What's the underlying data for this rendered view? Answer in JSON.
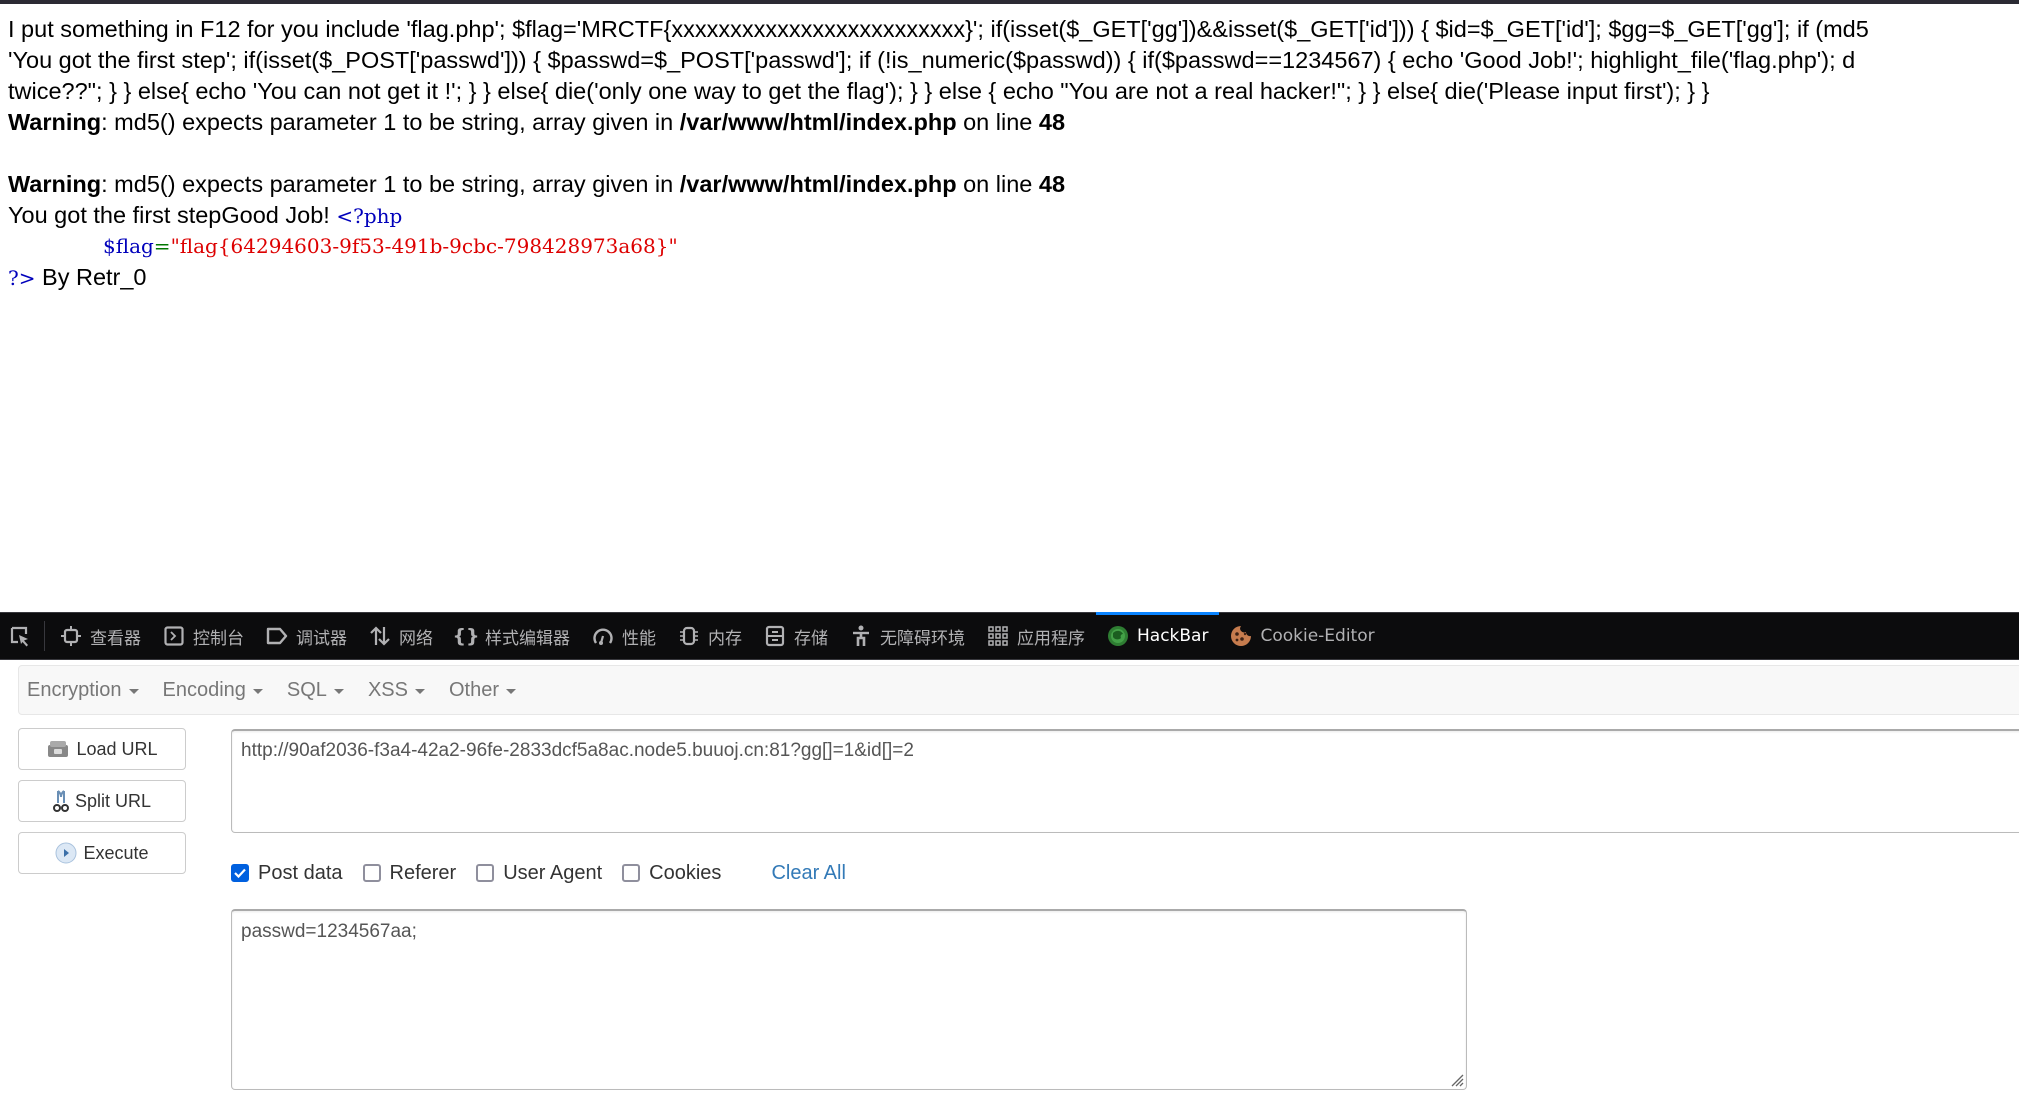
{
  "page": {
    "source_lines": [
      "I put something in F12 for you include 'flag.php'; $flag='MRCTF{xxxxxxxxxxxxxxxxxxxxxxxxx}'; if(isset($_GET['gg'])&&isset($_GET['id'])) { $id=$_GET['id']; $gg=$_GET['gg']; if (md5",
      "'You got the first step'; if(isset($_POST['passwd'])) { $passwd=$_POST['passwd']; if (!is_numeric($passwd)) { if($passwd==1234567) { echo 'Good Job!'; highlight_file('flag.php'); d",
      "twice??\"; } } else{ echo 'You can not get it !'; } } else{ die('only one way to get the flag'); } } else { echo \"You are not a real hacker!\"; } } else{ die('Please input first'); } }"
    ],
    "warnings": [
      {
        "label": "Warning",
        "message": ": md5() expects parameter 1 to be string, array given in ",
        "file": "/var/www/html/index.php",
        "on_line": " on line ",
        "line": "48"
      },
      {
        "label": "Warning",
        "message": ": md5() expects parameter 1 to be string, array given in ",
        "file": "/var/www/html/index.php",
        "on_line": " on line ",
        "line": "48"
      }
    ],
    "output_text": "You got the first stepGood Job! ",
    "php_open": "<?php",
    "flag_var": "$flag",
    "flag_eq": "=",
    "flag_value": "\"flag{64294603-9f53-491b-9cbc-798428973a68}\"",
    "php_close": "?>",
    "signature": " By Retr_0"
  },
  "devtools": {
    "tabs": [
      {
        "label": "查看器",
        "icon": "inspector-icon"
      },
      {
        "label": "控制台",
        "icon": "console-icon"
      },
      {
        "label": "调试器",
        "icon": "debugger-icon"
      },
      {
        "label": "网络",
        "icon": "network-icon"
      },
      {
        "label": "样式编辑器",
        "icon": "style-editor-icon"
      },
      {
        "label": "性能",
        "icon": "performance-icon"
      },
      {
        "label": "内存",
        "icon": "memory-icon"
      },
      {
        "label": "存储",
        "icon": "storage-icon"
      },
      {
        "label": "无障碍环境",
        "icon": "accessibility-icon"
      },
      {
        "label": "应用程序",
        "icon": "application-icon"
      },
      {
        "label": "HackBar",
        "icon": "hackbar-icon",
        "active": true
      },
      {
        "label": "Cookie-Editor",
        "icon": "cookie-icon"
      }
    ],
    "accent_color": "#0a84ff"
  },
  "hackbar": {
    "menu": [
      "Encryption",
      "Encoding",
      "SQL",
      "XSS",
      "Other"
    ],
    "buttons": {
      "load_url": "Load URL",
      "split_url": "Split URL",
      "execute": "Execute"
    },
    "url_value": "http://90af2036-f3a4-42a2-96fe-2833dcf5a8ac.node5.buuoj.cn:81?gg[]=1&id[]=2",
    "options": [
      {
        "label": "Post data",
        "checked": true
      },
      {
        "label": "Referer",
        "checked": false
      },
      {
        "label": "User Agent",
        "checked": false
      },
      {
        "label": "Cookies",
        "checked": false
      }
    ],
    "clear_all": "Clear All",
    "post_value": "passwd=1234567aa;"
  }
}
